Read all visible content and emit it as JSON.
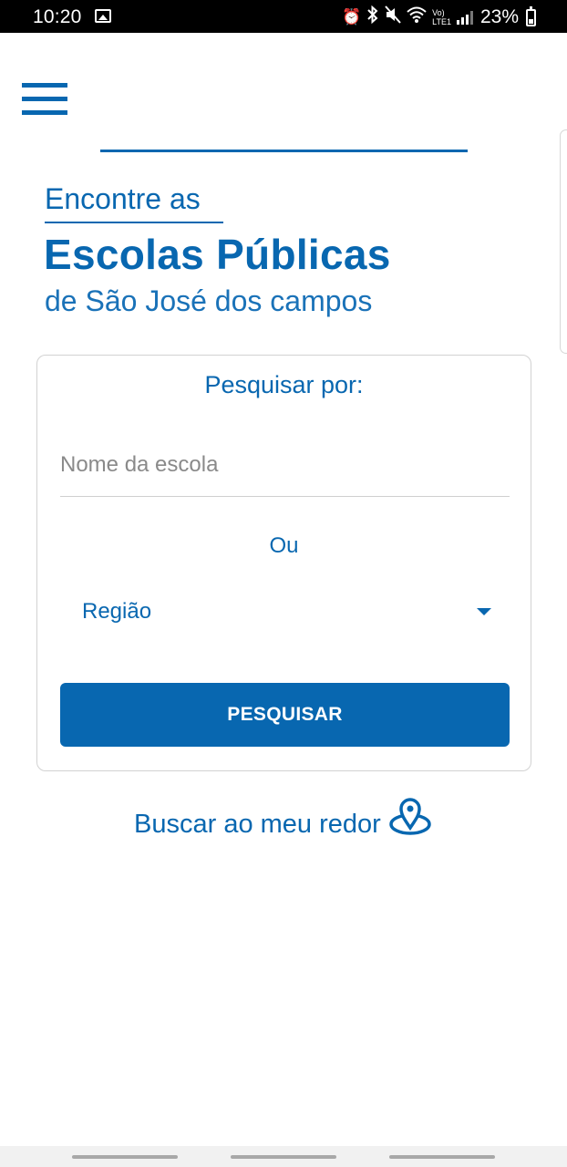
{
  "status_bar": {
    "time": "10:20",
    "battery": "23%",
    "icons": [
      "image-icon",
      "alarm-icon",
      "bluetooth-icon",
      "mute-icon",
      "wifi-icon",
      "volte-icon",
      "signal-icon",
      "battery-icon"
    ],
    "volte_top": "Vo)",
    "volte_bottom": "LTE1"
  },
  "header": {
    "menu_icon": "hamburger-menu-icon"
  },
  "headline": {
    "pre": "Encontre as",
    "main": "Escolas Públicas",
    "sub": "de São José dos campos"
  },
  "search": {
    "title": "Pesquisar por:",
    "school_placeholder": "Nome da escola",
    "school_value": "",
    "or_label": "Ou",
    "region_label": "Região",
    "button_label": "PESQUISAR"
  },
  "nearby": {
    "label": "Buscar ao meu redor",
    "icon": "location-pin-icon"
  },
  "colors": {
    "primary": "#0867b0",
    "placeholder": "#8a8a8a",
    "border": "#d2d2d2"
  }
}
